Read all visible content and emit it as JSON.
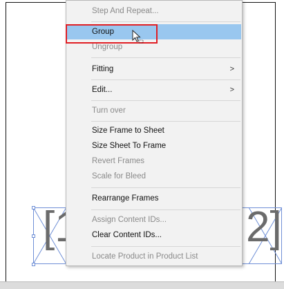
{
  "menu": {
    "items": [
      {
        "label": "Step And Repeat...",
        "disabled": true,
        "submenu": false
      },
      {
        "label": "Group",
        "disabled": false,
        "submenu": false,
        "highlighted": true
      },
      {
        "label": "Ungroup",
        "disabled": true,
        "submenu": false
      },
      {
        "label": "Fitting",
        "disabled": false,
        "submenu": true
      },
      {
        "label": "Edit...",
        "disabled": false,
        "submenu": true
      },
      {
        "label": "Turn over",
        "disabled": true,
        "submenu": false
      },
      {
        "label": "Size Frame to Sheet",
        "disabled": false,
        "submenu": false
      },
      {
        "label": "Size Sheet To Frame",
        "disabled": false,
        "submenu": false
      },
      {
        "label": "Revert Frames",
        "disabled": true,
        "submenu": false
      },
      {
        "label": "Scale for Bleed",
        "disabled": true,
        "submenu": false
      },
      {
        "label": "Rearrange Frames",
        "disabled": false,
        "submenu": false
      },
      {
        "label": "Assign Content IDs...",
        "disabled": true,
        "submenu": false
      },
      {
        "label": "Clear Content IDs...",
        "disabled": false,
        "submenu": false
      },
      {
        "label": "Locate Product in Product List",
        "disabled": true,
        "submenu": false
      }
    ],
    "submenu_arrow": ">"
  },
  "canvas": {
    "left_glyph": "[1",
    "right_glyph": "2]"
  },
  "colors": {
    "highlight": "#99c7ef",
    "annotation_red": "#e01e24",
    "frame_blue": "#6f8fd6"
  }
}
